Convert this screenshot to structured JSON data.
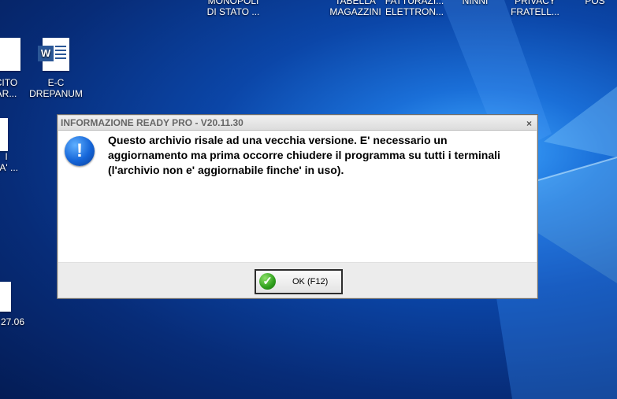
{
  "desktop": {
    "icons": [
      {
        "id": "monopoli",
        "label": "MONOPOLI\nDI STATO ..."
      },
      {
        "id": "tabella",
        "label": "TABELLA\nMAGAZZINI"
      },
      {
        "id": "fatturazi",
        "label": "FATTURAZI...\nELETTRON..."
      },
      {
        "id": "ninni",
        "label": "NINNI"
      },
      {
        "id": "privacy",
        "label": "PRIVACY\nFRATELL..."
      },
      {
        "id": "pos",
        "label": "POS"
      },
      {
        "id": "cito",
        "label": "CITO\nAR..."
      },
      {
        "id": "ec",
        "label": "E-C\nDREPANUM"
      },
      {
        "id": "ta",
        "label": "I\nTA' ..."
      },
      {
        "id": "date",
        "label": "27.06"
      }
    ]
  },
  "dialog": {
    "title": "INFORMAZIONE READY PRO - V20.11.30",
    "close_glyph": "×",
    "icon_glyph": "!",
    "message": "Questo archivio risale ad una vecchia versione. E' necessario un aggiornamento ma prima occorre chiudere il programma su tutti i terminali (l'archivio non e' aggiornabile finche' in uso).",
    "ok_label": "OK (F12)",
    "ok_icon_glyph": "✓"
  },
  "colors": {
    "desktop_bg": "#0b46a8",
    "dialog_bg": "#ffffff",
    "footer_bg": "#ececec",
    "info_icon": "#1565d8",
    "ok_icon": "#2e9e1c"
  }
}
